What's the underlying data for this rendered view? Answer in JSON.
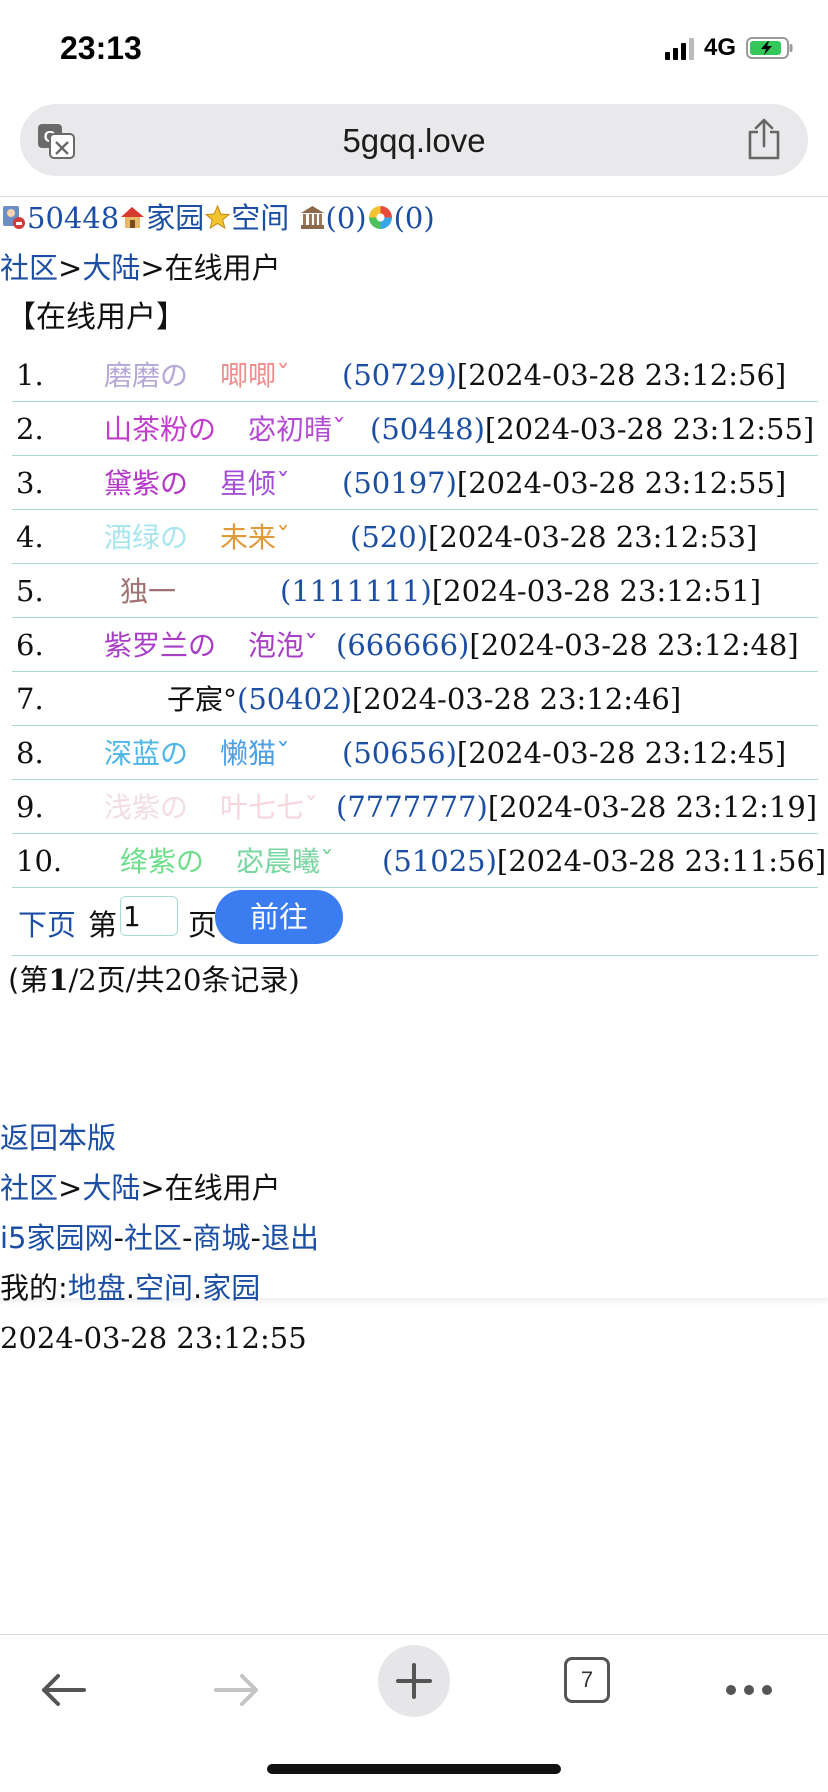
{
  "status": {
    "time": "23:13",
    "network": "4G"
  },
  "browser": {
    "url": "5gqq.love",
    "tab_count": "7"
  },
  "header": {
    "user_id": "50448",
    "home_label": "家园",
    "space_label": "空间",
    "count1": "(0)",
    "count2": "(0)"
  },
  "breadcrumb": {
    "community": "社区",
    "sep1": ">",
    "mainland": "大陆",
    "sep2": ">",
    "current": "在线用户"
  },
  "section_title": "【在线用户】",
  "users": [
    {
      "num": "1.",
      "name_a": "磨磨の",
      "name_b": "唧唧ˇ",
      "color_a": "#b5a8d8",
      "color_b": "#f08d8d",
      "uid": "(50729)",
      "time": "[2024-03-28 23:12:56]"
    },
    {
      "num": "2.",
      "name_a": "山茶粉の",
      "name_b": "宓初晴ˇ",
      "color_a": "#c23ccc",
      "color_b": "#b44ad4",
      "uid": "(50448)",
      "time": "[2024-03-28 23:12:55]"
    },
    {
      "num": "3.",
      "name_a": "黛紫の",
      "name_b": "星倾ˇ",
      "color_a": "#b436c8",
      "color_b": "#a44dd8",
      "uid": "(50197)",
      "time": "[2024-03-28 23:12:55]"
    },
    {
      "num": "4.",
      "name_a": "酒绿の",
      "name_b": "未来ˇ",
      "color_a": "#a8e6ee",
      "color_b": "#e09a3a",
      "uid": "(520)",
      "time": "[2024-03-28 23:12:53]"
    },
    {
      "num": "5.",
      "name_a": "独一",
      "name_b": "",
      "color_a": "#a07272",
      "color_b": "#a07272",
      "uid": "(1111111)",
      "time": "[2024-03-28 23:12:51]"
    },
    {
      "num": "6.",
      "name_a": "紫罗兰の",
      "name_b": "泡泡ˇ",
      "color_a": "#a83ec6",
      "color_b": "#a83ec6",
      "uid": "(666666)",
      "time": "[2024-03-28 23:12:48]"
    },
    {
      "num": "7.",
      "name_a": "子宸°",
      "name_b": "",
      "color_a": "#111111",
      "color_b": "#111111",
      "uid": "(50402)",
      "time": "[2024-03-28 23:12:46]"
    },
    {
      "num": "8.",
      "name_a": "深蓝の",
      "name_b": "懒猫ˇ",
      "color_a": "#4cb6e8",
      "color_b": "#4c9ee6",
      "uid": "(50656)",
      "time": "[2024-03-28 23:12:45]"
    },
    {
      "num": "9.",
      "name_a": "浅紫の",
      "name_b": "叶七七ˇ",
      "color_a": "#f2dce6",
      "color_b": "#f6d6dc",
      "uid": "(7777777)",
      "time": "[2024-03-28 23:12:19]"
    },
    {
      "num": "10.",
      "name_a": "绛紫の",
      "name_b": "宓晨曦ˇ",
      "color_a": "#6ede8a",
      "color_b": "#78d6a0",
      "uid": "(51025)",
      "time": "[2024-03-28 23:11:56]"
    }
  ],
  "pager": {
    "next": "下页",
    "page_prefix": "第",
    "page_value": "1",
    "page_suffix": "页",
    "go": "前往"
  },
  "record_info": {
    "open": "(第",
    "current": "1",
    "rest": "/2页/共20条记录)"
  },
  "footer": {
    "back": "返回本版",
    "crumb_community": "社区",
    "crumb_mainland": "大陆",
    "crumb_current": "在线用户",
    "site": "i5家园网",
    "community": "社区",
    "mall": "商城",
    "logout": "退出",
    "mine_label": "我的:",
    "land": "地盘",
    "space": "空间",
    "home": "家园",
    "datetime": "2024-03-28 23:12:55"
  }
}
